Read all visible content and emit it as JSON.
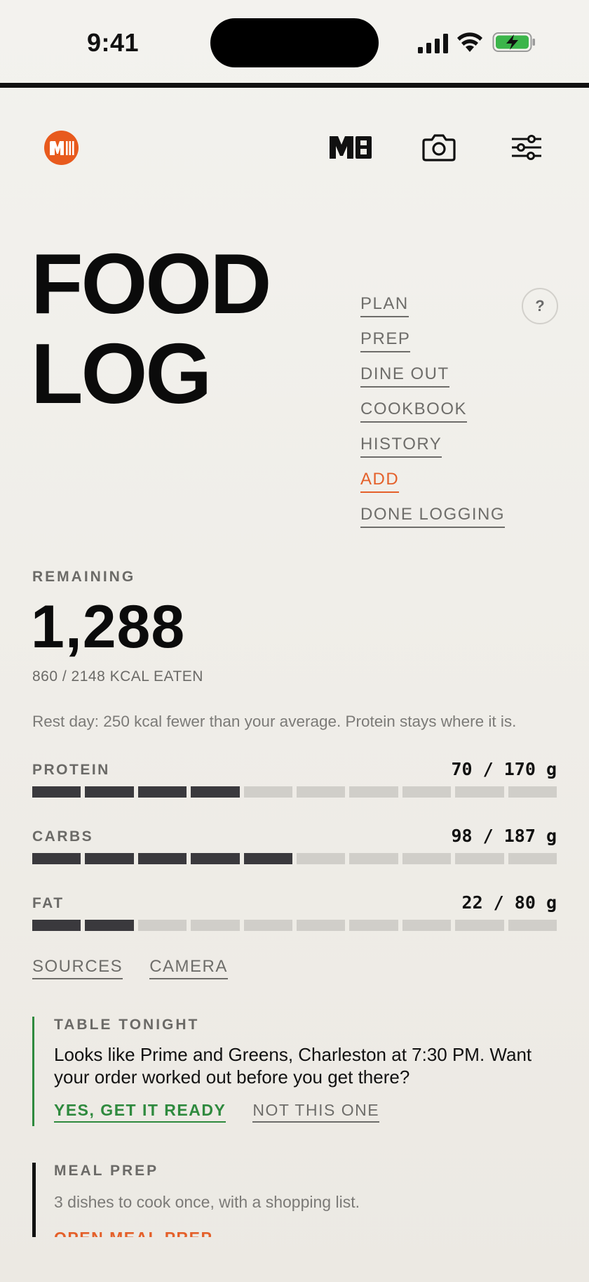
{
  "status_bar": {
    "time": "9:41",
    "signal_icon": "cellular-signal-icon",
    "wifi_icon": "wifi-icon",
    "battery_icon": "battery-charging-icon",
    "battery_color": "#3bb54a"
  },
  "header": {
    "logo_text": "M",
    "icons": [
      "mb-icon",
      "camera-icon",
      "filter-sliders-icon"
    ],
    "accent_color": "#e85a1d"
  },
  "title": {
    "line1": "FOOD",
    "line2": "LOG"
  },
  "help": {
    "label": "?"
  },
  "menu": {
    "items": [
      {
        "label": "PLAN"
      },
      {
        "label": "PREP"
      },
      {
        "label": "DINE OUT"
      },
      {
        "label": "COOKBOOK"
      },
      {
        "label": "HISTORY"
      },
      {
        "label": "ADD"
      },
      {
        "label": "DONE LOGGING"
      }
    ]
  },
  "summary": {
    "remaining_label": "REMAINING",
    "remaining_value": "1,288",
    "eaten_text": "860 / 2148 KCAL EATEN",
    "note": "Rest day: 250 kcal fewer than your average. Protein stays where it is."
  },
  "macros": [
    {
      "name": "PROTEIN",
      "value": "70 / 170 g",
      "filled_segments": 4,
      "total_segments": 10
    },
    {
      "name": "CARBS",
      "value": "98 / 187 g",
      "filled_segments": 5,
      "total_segments": 10
    },
    {
      "name": "FAT",
      "value": "22 / 80 g",
      "filled_segments": 2,
      "total_segments": 10
    }
  ],
  "links": {
    "sources": "SOURCES",
    "camera": "CAMERA"
  },
  "table_card": {
    "label": "TABLE TONIGHT",
    "body": "Looks like Prime and Greens, Charleston at 7:30 PM. Want your order worked out before you get there?",
    "yes": "YES, GET IT READY",
    "no": "NOT THIS ONE"
  },
  "prep_card": {
    "label": "MEAL PREP",
    "body": "3 dishes to cook once, with a shopping list.",
    "link": "OPEN MEAL PREP"
  }
}
